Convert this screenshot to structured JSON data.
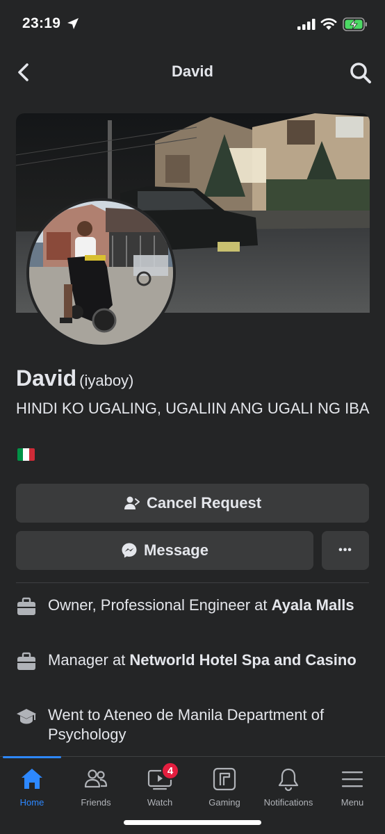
{
  "status_bar": {
    "time": "23:19"
  },
  "nav": {
    "title": "David"
  },
  "profile": {
    "name": "David",
    "alternate_name": "(iyaboy)",
    "bio": "HINDI KO UGALING, UGALIIN ANG UGALI NG IBA",
    "flag_icon": "italy-flag-icon",
    "flag_colors": [
      "#009246",
      "#ffffff",
      "#ce2b37"
    ]
  },
  "actions": {
    "cancel_request_label": "Cancel Request",
    "message_label": "Message",
    "more_label": "•••"
  },
  "intro": [
    {
      "icon": "briefcase-icon",
      "prefix": "Owner, Professional Engineer at ",
      "bold": "Ayala Malls"
    },
    {
      "icon": "briefcase-icon",
      "prefix": "Manager at ",
      "bold": "Networld Hotel Spa and Casino"
    },
    {
      "icon": "graduation-cap-icon",
      "prefix": "Went to Ateneo de Manila Department of Psychology",
      "bold": ""
    }
  ],
  "tabs": [
    {
      "label": "Home",
      "icon": "home-icon",
      "active": true
    },
    {
      "label": "Friends",
      "icon": "friends-icon"
    },
    {
      "label": "Watch",
      "icon": "watch-icon",
      "badge": "4"
    },
    {
      "label": "Gaming",
      "icon": "gaming-icon"
    },
    {
      "label": "Notifications",
      "icon": "bell-icon"
    },
    {
      "label": "Menu",
      "icon": "hamburger-icon"
    }
  ],
  "colors": {
    "background": "#242526",
    "button": "#3a3b3c",
    "accent": "#2d88ff",
    "badge": "#e41e3f"
  }
}
